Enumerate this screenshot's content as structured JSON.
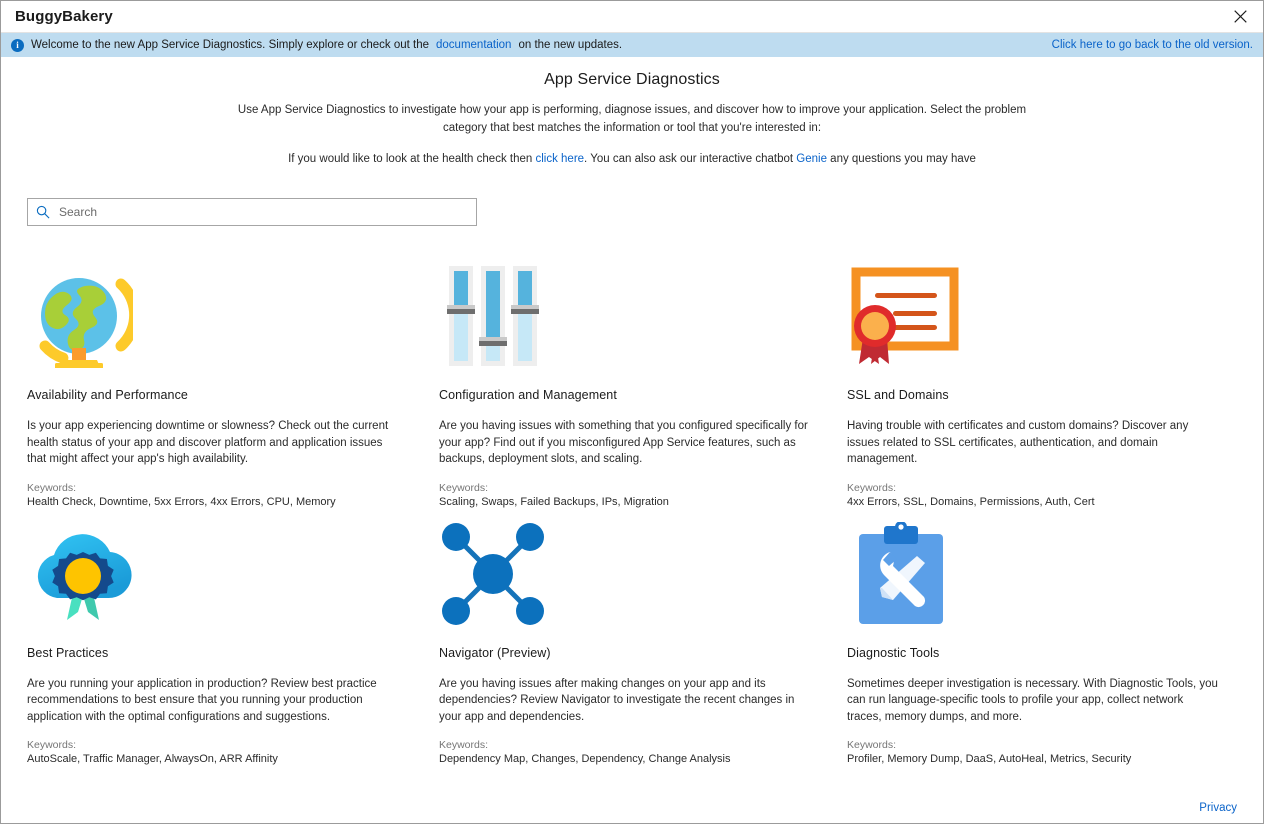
{
  "window": {
    "title": "BuggyBakery",
    "close_icon": "close-icon"
  },
  "banner": {
    "info_icon": "info-icon",
    "text_before_link": "Welcome to the new App Service Diagnostics. Simply explore or check out the ",
    "link_text": "documentation",
    "text_after_link": " on the new updates.",
    "right_link": "Click here to go back to the old version.",
    "background_color": "#bedcf0",
    "link_color": "#0a63c9"
  },
  "intro": {
    "title": "App Service Diagnostics",
    "paragraph": "Use App Service Diagnostics to investigate how your app is performing, diagnose issues, and discover how to improve your application. Select the problem category that best matches the information or tool that you're interested in:",
    "health_prefix": "If you would like to look at the health check then ",
    "health_link": "click here",
    "health_middle": ". You can also ask our interactive chatbot ",
    "genie_link": "Genie",
    "health_suffix": " any questions you may have"
  },
  "search": {
    "placeholder": "Search",
    "value": "",
    "icon": "search-icon"
  },
  "cards": [
    {
      "icon": "globe-icon",
      "title": "Availability and Performance",
      "description": "Is your app experiencing downtime or slowness? Check out the current health status of your app and discover platform and application issues that might affect your app's high availability.",
      "keywords_label": "Keywords:",
      "keywords": "Health Check, Downtime, 5xx Errors, 4xx Errors, CPU, Memory"
    },
    {
      "icon": "sliders-icon",
      "title": "Configuration and Management",
      "description": "Are you having issues with something that you configured specifically for your app? Find out if you misconfigured App Service features, such as backups, deployment slots, and scaling.",
      "keywords_label": "Keywords:",
      "keywords": "Scaling, Swaps, Failed Backups, IPs, Migration"
    },
    {
      "icon": "certificate-icon",
      "title": "SSL and Domains",
      "description": "Having trouble with certificates and custom domains? Discover any issues related to SSL certificates, authentication, and domain management.",
      "keywords_label": "Keywords:",
      "keywords": "4xx Errors, SSL, Domains, Permissions, Auth, Cert"
    },
    {
      "icon": "cloud-award-icon",
      "title": "Best Practices",
      "description": "Are you running your application in production? Review best practice recommendations to best ensure that you running your production application with the optimal configurations and suggestions.",
      "keywords_label": "Keywords:",
      "keywords": "AutoScale, Traffic Manager, AlwaysOn, ARR Affinity"
    },
    {
      "icon": "network-nodes-icon",
      "title": "Navigator (Preview)",
      "description": "Are you having issues after making changes on your app and its dependencies? Review Navigator to investigate the recent changes in your app and dependencies.",
      "keywords_label": "Keywords:",
      "keywords": "Dependency Map, Changes, Dependency, Change Analysis"
    },
    {
      "icon": "clipboard-tools-icon",
      "title": "Diagnostic Tools",
      "description": "Sometimes deeper investigation is necessary. With Diagnostic Tools, you can run language-specific tools to profile your app, collect network traces, memory dumps, and more.",
      "keywords_label": "Keywords:",
      "keywords": "Profiler, Memory Dump, DaaS, AutoHeal, Metrics, Security"
    }
  ],
  "footer": {
    "privacy_label": "Privacy"
  }
}
